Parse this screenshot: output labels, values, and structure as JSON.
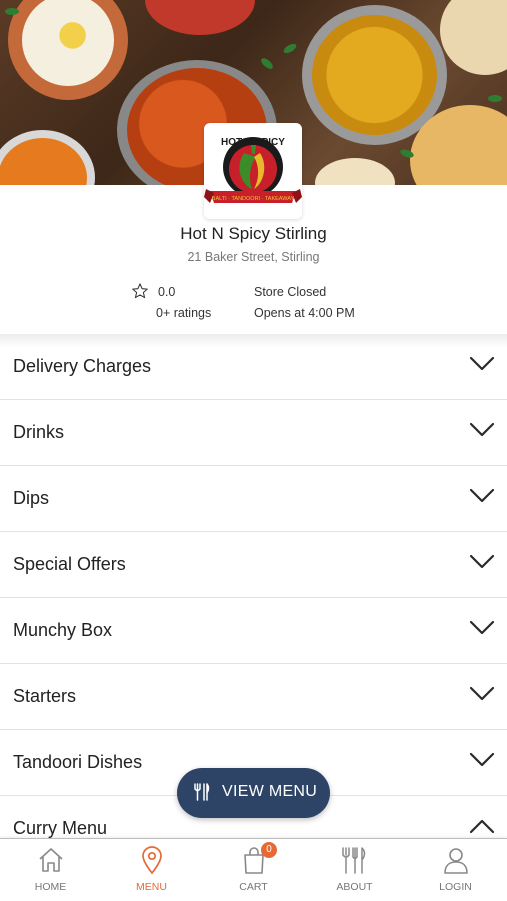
{
  "store": {
    "name": "Hot N Spicy Stirling",
    "address": "21 Baker Street, Stirling",
    "rating": "0.0",
    "ratings_count": "0+ ratings",
    "status": "Store Closed",
    "opens": "Opens at 4:00 PM",
    "logo_text": "HOT N SPICY",
    "logo_banner": "BALTI · TANDOORI · TAKEAWAY"
  },
  "categories": [
    {
      "label": "Delivery Charges",
      "expanded": false
    },
    {
      "label": "Drinks",
      "expanded": false
    },
    {
      "label": "Dips",
      "expanded": false
    },
    {
      "label": "Special Offers",
      "expanded": false
    },
    {
      "label": "Munchy Box",
      "expanded": false
    },
    {
      "label": "Starters",
      "expanded": false
    },
    {
      "label": "Tandoori Dishes",
      "expanded": false
    },
    {
      "label": "Curry Menu",
      "expanded": true
    }
  ],
  "view_menu": {
    "label": "VIEW MENU",
    "icon": "cutlery-icon"
  },
  "tabs": [
    {
      "label": "HOME",
      "icon": "home-icon",
      "active": false
    },
    {
      "label": "MENU",
      "icon": "location-pin-icon",
      "active": true
    },
    {
      "label": "CART",
      "icon": "shopping-bag-icon",
      "active": false,
      "badge": "0"
    },
    {
      "label": "ABOUT",
      "icon": "cutlery-icon",
      "active": false
    },
    {
      "label": "LOGIN",
      "icon": "user-icon",
      "active": false
    }
  ],
  "colors": {
    "accent": "#e46a36",
    "pill": "#2d4466",
    "logo_red": "#c8202a",
    "logo_yellow": "#f2c230"
  }
}
